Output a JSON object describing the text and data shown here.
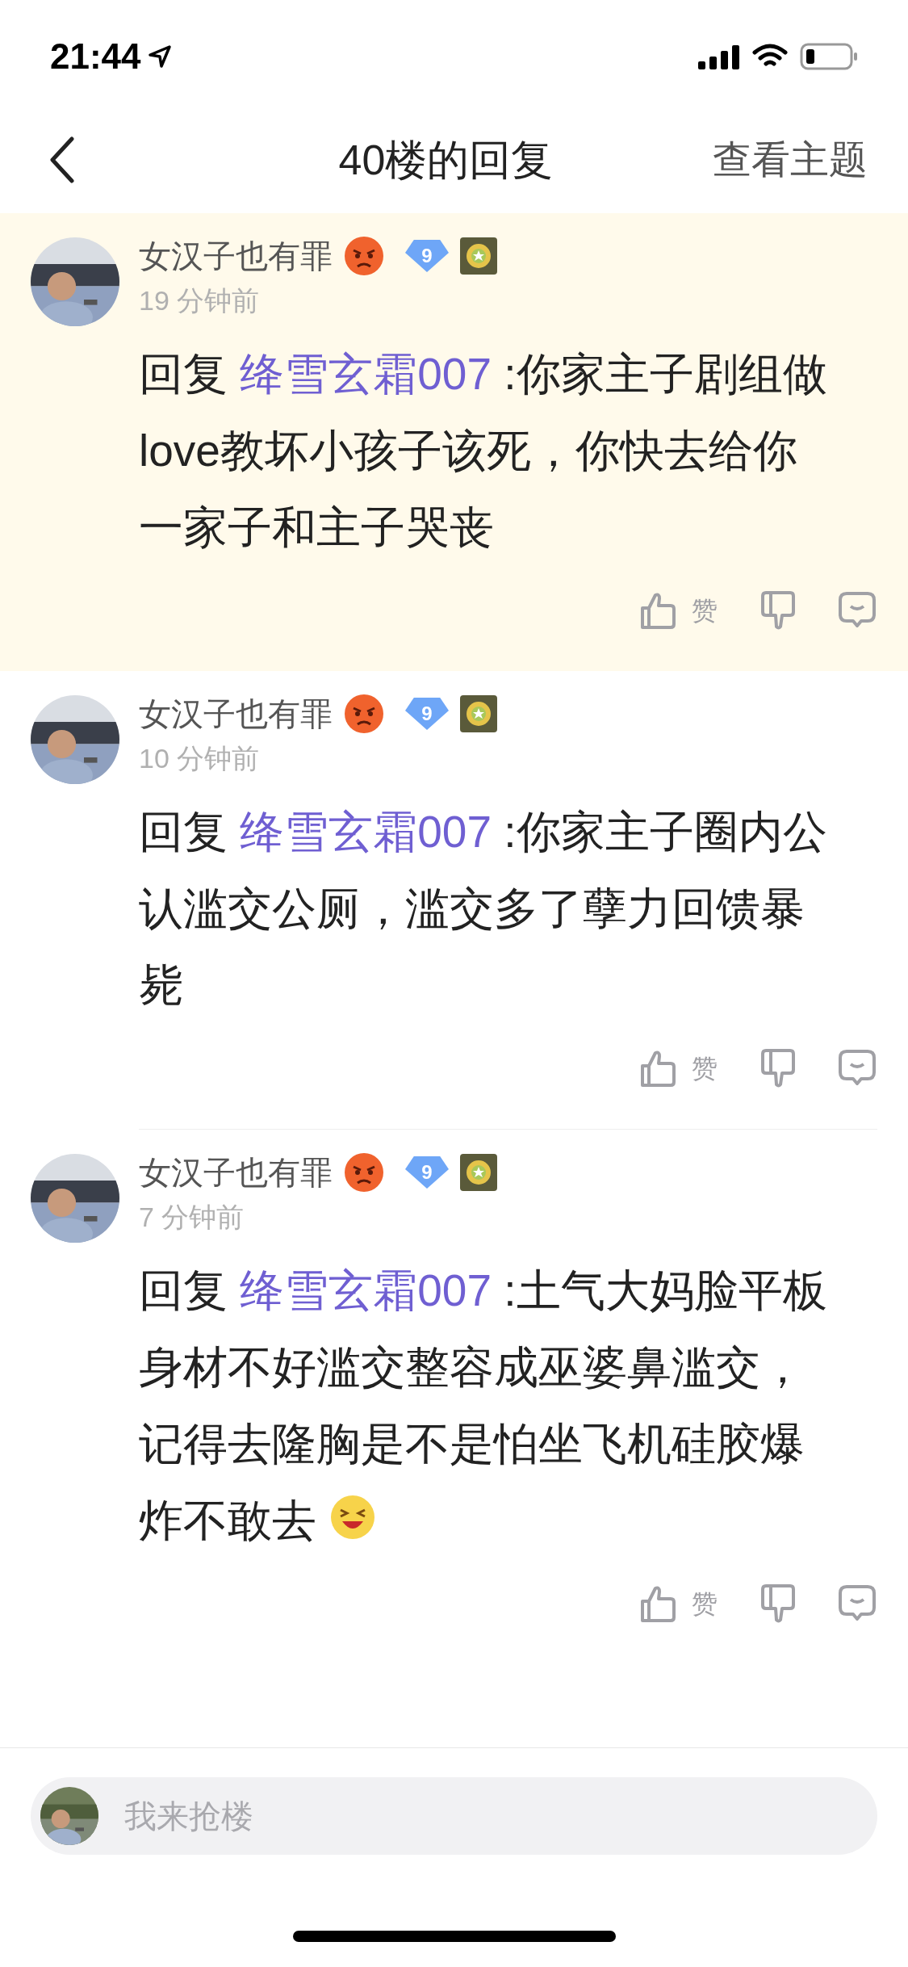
{
  "status_bar": {
    "time": "21:44"
  },
  "nav": {
    "title": "40楼的回复",
    "right_action": "查看主题"
  },
  "comments": [
    {
      "highlighted": true,
      "username": "女汉子也有罪",
      "level": "9",
      "time": "19 分钟前",
      "reply_prefix": "回复",
      "reply_to": "绛雪玄霜007",
      "text": ":你家主子剧组做love教坏小孩子该死，你快去给你一家子和主子哭丧",
      "has_emoji": false,
      "like_label": "赞"
    },
    {
      "highlighted": false,
      "username": "女汉子也有罪",
      "level": "9",
      "time": "10 分钟前",
      "reply_prefix": "回复",
      "reply_to": "绛雪玄霜007",
      "text": ":你家主子圈内公认滥交公厕，滥交多了孽力回馈暴毙",
      "has_emoji": false,
      "like_label": "赞"
    },
    {
      "highlighted": false,
      "username": "女汉子也有罪",
      "level": "9",
      "time": "7 分钟前",
      "reply_prefix": "回复",
      "reply_to": "绛雪玄霜007",
      "text": ":土气大妈脸平板身材不好滥交整容成巫婆鼻滥交，记得去隆胸是不是怕坐飞机硅胶爆炸不敢去",
      "has_emoji": true,
      "like_label": "赞"
    }
  ],
  "reply_bar": {
    "placeholder": "我来抢楼"
  }
}
